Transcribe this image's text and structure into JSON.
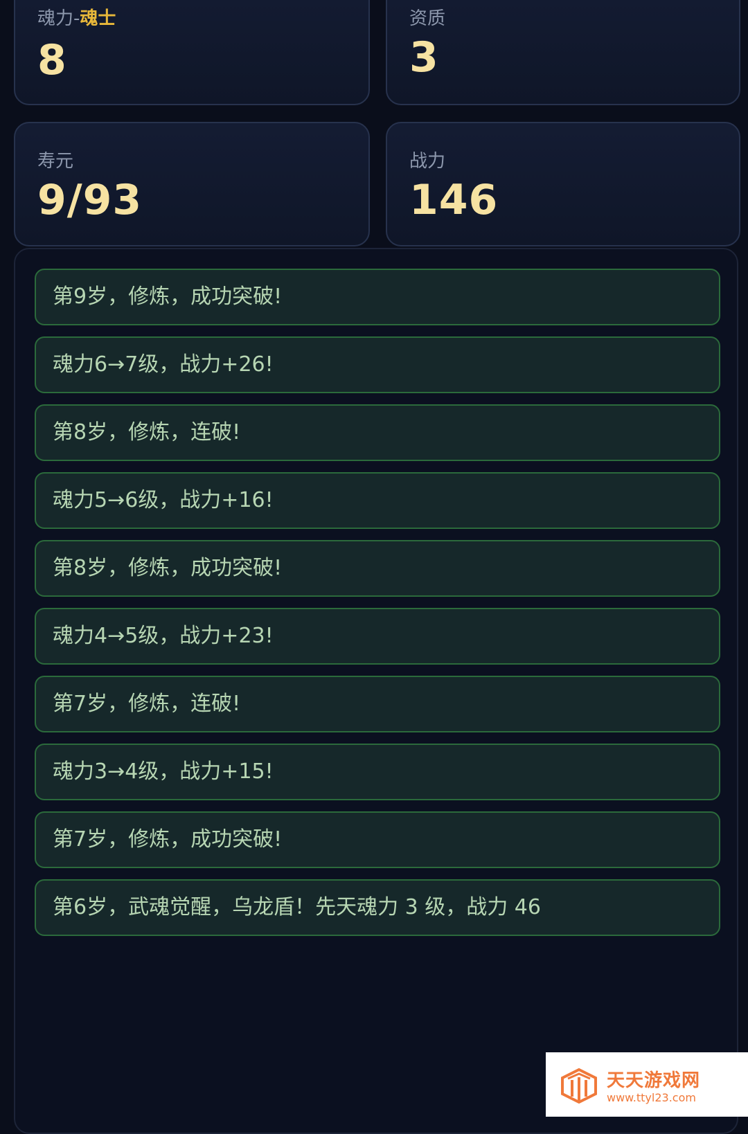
{
  "stats": {
    "soul_power": {
      "label": "魂力-",
      "rank": "魂士",
      "value": "8"
    },
    "aptitude": {
      "label": "资质",
      "value": "3"
    },
    "lifespan": {
      "label": "寿元",
      "value": "9/93"
    },
    "combat_power": {
      "label": "战力",
      "value": "146"
    }
  },
  "log": [
    "第9岁，修炼，成功突破!",
    "魂力6→7级，战力+26!",
    "第8岁，修炼，连破!",
    "魂力5→6级，战力+16!",
    "第8岁，修炼，成功突破!",
    "魂力4→5级，战力+23!",
    "第7岁，修炼，连破!",
    "魂力3→4级，战力+15!",
    "第7岁，修炼，成功突破!",
    "第6岁，武魂觉醒，乌龙盾！先天魂力 3 级，战力 46"
  ],
  "watermark": {
    "title": "天天游戏网",
    "url": "www.ttyl23.com",
    "color": "#f0793a"
  }
}
